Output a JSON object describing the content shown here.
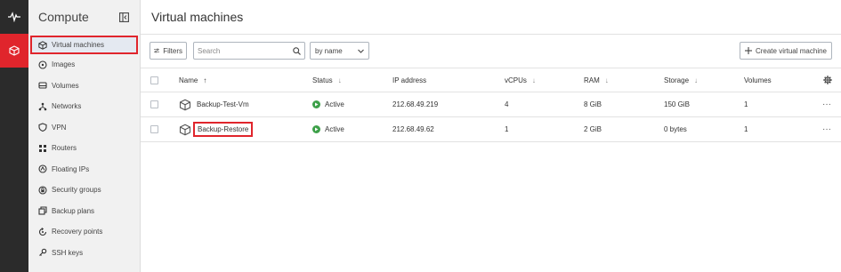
{
  "sidebar": {
    "title": "Compute",
    "items": [
      {
        "label": "Virtual machines",
        "icon": "cube-icon",
        "active": true
      },
      {
        "label": "Images",
        "icon": "disc-icon"
      },
      {
        "label": "Volumes",
        "icon": "hdd-icon"
      },
      {
        "label": "Networks",
        "icon": "network-icon"
      },
      {
        "label": "VPN",
        "icon": "shield-icon"
      },
      {
        "label": "Routers",
        "icon": "router-icon"
      },
      {
        "label": "Floating IPs",
        "icon": "floating-ip-icon"
      },
      {
        "label": "Security groups",
        "icon": "security-group-icon"
      },
      {
        "label": "Backup plans",
        "icon": "backup-plan-icon"
      },
      {
        "label": "Recovery points",
        "icon": "recovery-icon"
      },
      {
        "label": "SSH keys",
        "icon": "key-icon"
      }
    ]
  },
  "main": {
    "title": "Virtual machines",
    "toolbar": {
      "filters_label": "Filters",
      "search_placeholder": "Search",
      "sort_value": "by name",
      "create_label": "Create virtual machine"
    },
    "columns": {
      "name": "Name",
      "status": "Status",
      "ip": "IP address",
      "vcpus": "vCPUs",
      "ram": "RAM",
      "storage": "Storage",
      "volumes": "Volumes"
    },
    "rows": [
      {
        "name": "Backup-Test-Vm",
        "status": "Active",
        "ip": "212.68.49.219",
        "vcpus": "4",
        "ram": "8 GiB",
        "storage": "150 GiB",
        "volumes": "1",
        "more": "···"
      },
      {
        "name": "Backup-Restore",
        "status": "Active",
        "ip": "212.68.49.62",
        "vcpus": "1",
        "ram": "2 GiB",
        "storage": "0 bytes",
        "volumes": "1",
        "more": "···"
      }
    ]
  },
  "colors": {
    "accent": "#e0252c",
    "rail_bg": "#2b2b2b",
    "sidebar_bg": "#f1f1f1",
    "active_status": "#3da049"
  }
}
